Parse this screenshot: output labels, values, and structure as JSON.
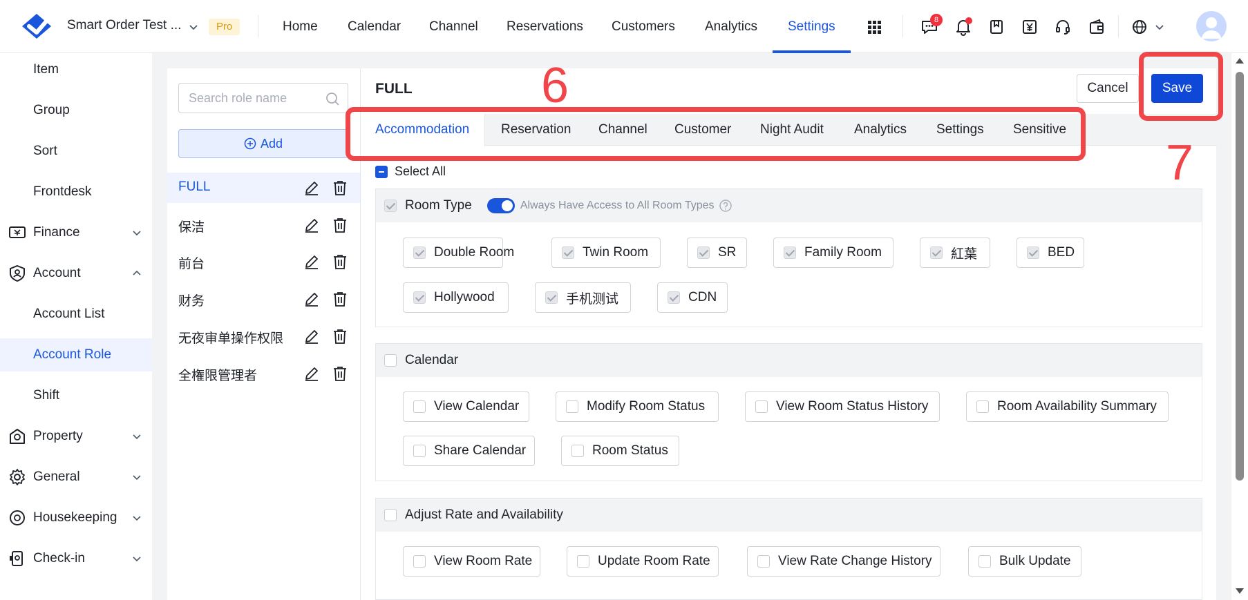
{
  "topbar": {
    "brand": "Smart Order Test ...",
    "plan_badge": "Pro",
    "nav": [
      "Home",
      "Calendar",
      "Channel",
      "Reservations",
      "Customers",
      "Analytics",
      "Settings"
    ],
    "active_nav": "Settings",
    "notification_count": "8",
    "accent_color": "#1a56db"
  },
  "sidebar": {
    "items": [
      {
        "label": "Item"
      },
      {
        "label": "Group"
      },
      {
        "label": "Sort"
      },
      {
        "label": "Frontdesk"
      },
      {
        "label": "Finance",
        "icon": "finance-icon",
        "expandable": true
      },
      {
        "label": "Account",
        "icon": "account-icon",
        "expanded": true
      },
      {
        "label": "Account List"
      },
      {
        "label": "Account Role",
        "active": true
      },
      {
        "label": "Shift"
      },
      {
        "label": "Property",
        "icon": "property-icon",
        "expandable": true
      },
      {
        "label": "General",
        "icon": "gear-icon",
        "expandable": true
      },
      {
        "label": "Housekeeping",
        "icon": "housekeeping-icon",
        "expandable": true
      },
      {
        "label": "Check-in",
        "icon": "checkin-icon",
        "expandable": true
      }
    ]
  },
  "roles": {
    "search_placeholder": "Search role name",
    "add_label": "Add",
    "items": [
      {
        "name": "FULL",
        "active": true
      },
      {
        "name": "保洁"
      },
      {
        "name": "前台"
      },
      {
        "name": "财务"
      },
      {
        "name": "无夜审单操作权限"
      },
      {
        "name": "全権限管理者"
      }
    ]
  },
  "detail": {
    "title": "FULL",
    "cancel_label": "Cancel",
    "save_label": "Save",
    "tabs": [
      "Accommodation",
      "Reservation",
      "Channel",
      "Customer",
      "Night Audit",
      "Analytics",
      "Settings",
      "Sensitive"
    ],
    "active_tab": "Accommodation",
    "select_all_label": "Select All",
    "sections": [
      {
        "title": "Room Type",
        "toggle_label": "Always Have Access to All Room Types",
        "toggle_on": true,
        "items": [
          "Double Room",
          "Twin Room",
          "SR",
          "Family Room",
          "紅葉",
          "BED",
          "Hollywood",
          "手机测试",
          "CDN"
        ]
      },
      {
        "title": "Calendar",
        "items": [
          "View Calendar",
          "Modify Room Status",
          "View Room Status History",
          "Room Availability Summary",
          "Share Calendar",
          "Room Status"
        ]
      },
      {
        "title": "Adjust Rate and Availability",
        "items": [
          "View Room Rate",
          "Update Room Rate",
          "View Rate Change History",
          "Bulk Update"
        ]
      }
    ]
  },
  "annotations": {
    "tabs_marker": "6",
    "save_marker": "7",
    "marker_color": "#f0464a"
  }
}
